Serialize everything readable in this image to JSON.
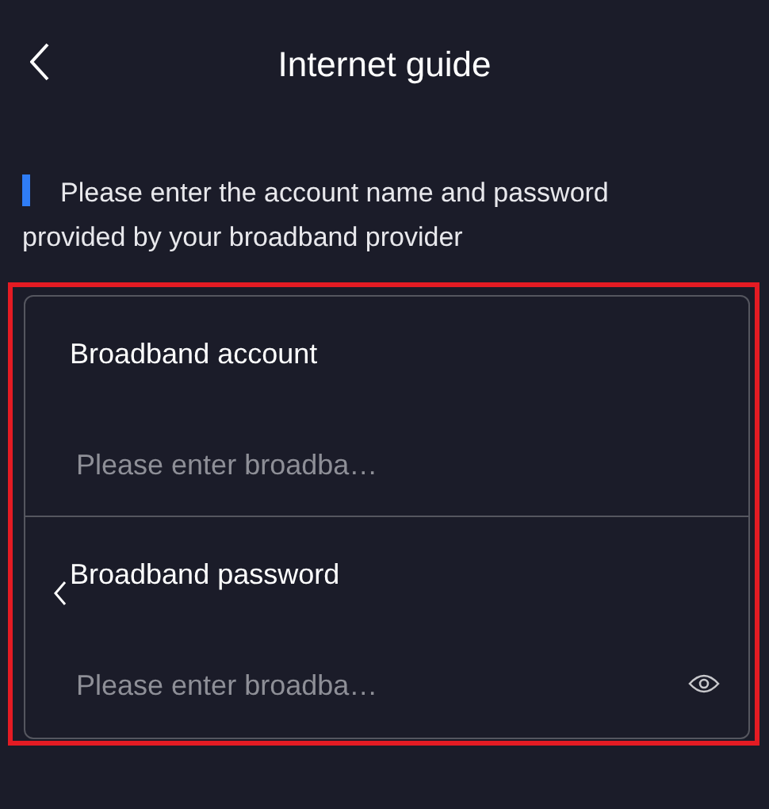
{
  "header": {
    "title": "Internet guide"
  },
  "instruction": "Please enter the account name and password provided by your broadband provider",
  "fields": [
    {
      "kind": "text",
      "label": "Broadband account",
      "placeholder": "Please enter broadba…"
    },
    {
      "kind": "password",
      "label": "Broadband password",
      "placeholder": "Please enter broadba…"
    }
  ]
}
